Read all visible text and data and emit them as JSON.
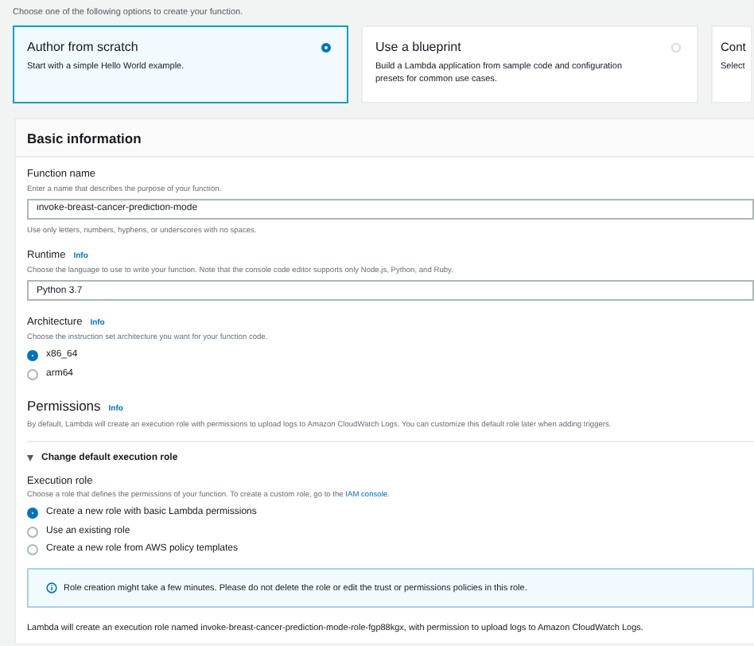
{
  "intro": "Choose one of the following options to create your function.",
  "options": [
    {
      "title": "Author from scratch",
      "description": "Start with a simple Hello World example.",
      "selected": true
    },
    {
      "title": "Use a blueprint",
      "description": "Build a Lambda application from sample code and configuration presets for common use cases.",
      "selected": false
    },
    {
      "title": "Cont",
      "description": "Select",
      "selected": false
    }
  ],
  "basic_information": {
    "title": "Basic information",
    "function_name": {
      "label": "Function name",
      "description": "Enter a name that describes the purpose of your function.",
      "value": "invoke-breast-cancer-prediction-mode",
      "constraint": "Use only letters, numbers, hyphens, or underscores with no spaces."
    },
    "runtime": {
      "label": "Runtime",
      "info": "Info",
      "description": "Choose the language to use to write your function. Note that the console code editor supports only Node.js, Python, and Ruby.",
      "value": "Python 3.7"
    },
    "architecture": {
      "label": "Architecture",
      "info": "Info",
      "description": "Choose the instruction set architecture you want for your function code.",
      "choices": [
        {
          "label": "x86_64",
          "selected": true
        },
        {
          "label": "arm64",
          "selected": false
        }
      ]
    }
  },
  "permissions": {
    "title": "Permissions",
    "info": "Info",
    "description": "By default, Lambda will create an execution role with permissions to upload logs to Amazon CloudWatch Logs. You can customize this default role later when adding triggers.",
    "expander": {
      "label": "Change default execution role",
      "expanded": true
    },
    "execution_role": {
      "label": "Execution role",
      "description": "Choose a role that defines the permissions of your function. To create a custom role, go to the",
      "link": "IAM console",
      "description_end": ".",
      "choices": [
        {
          "label": "Create a new role with basic Lambda permissions",
          "selected": true
        },
        {
          "label": "Use an existing role",
          "selected": false
        },
        {
          "label": "Create a new role from AWS policy templates",
          "selected": false
        }
      ]
    },
    "notice": "Role creation might take a few minutes. Please do not delete the role or edit the trust or permissions policies in this role.",
    "footer": "Lambda will create an execution role named invoke-breast-cancer-prediction-mode-role-fgp88kgx, with permission to upload logs to Amazon CloudWatch Logs."
  }
}
